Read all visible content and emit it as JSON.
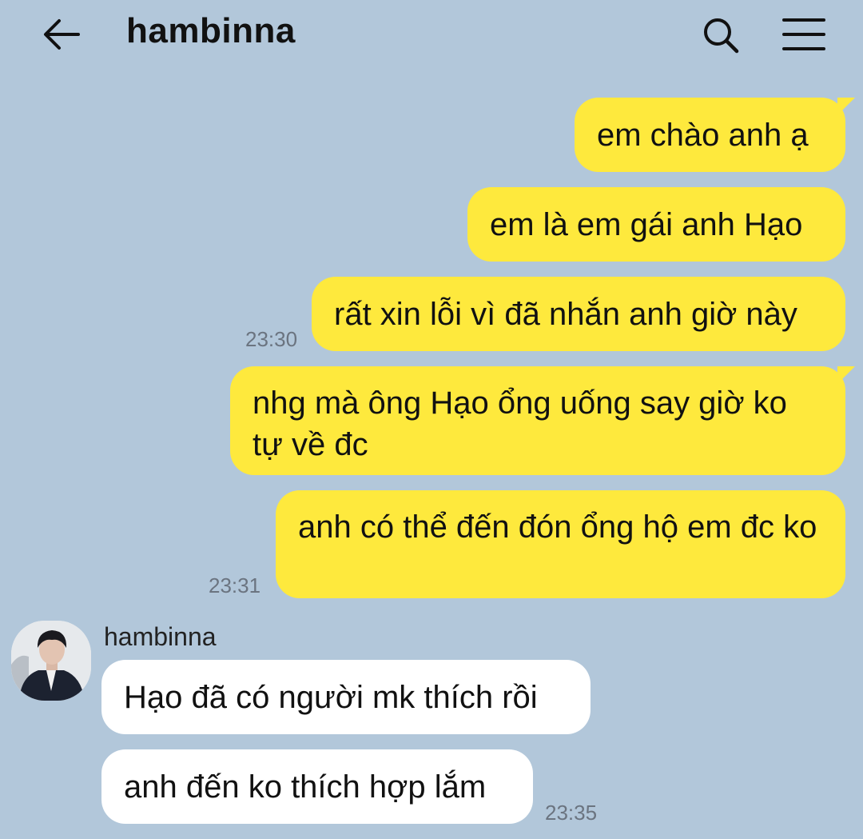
{
  "header": {
    "back_icon": "arrow-left-icon",
    "title": "hambinna",
    "search_icon": "search-icon",
    "menu_icon": "hamburger-menu-icon"
  },
  "colors": {
    "background": "#b2c7da",
    "outgoing_bubble": "#fee93d",
    "incoming_bubble": "#ffffff"
  },
  "messages": [
    {
      "direction": "outgoing",
      "text": "em chào anh ạ"
    },
    {
      "direction": "outgoing",
      "text": "em là em gái anh Hạo"
    },
    {
      "direction": "outgoing",
      "text": "rất xin lỗi vì đã nhắn anh giờ này",
      "time": "23:30"
    },
    {
      "direction": "outgoing",
      "text": "nhg mà ông Hạo ổng uống say giờ ko tự về đc"
    },
    {
      "direction": "outgoing",
      "text": "anh có thể đến đón ổng hộ em đc ko",
      "time": "23:31"
    },
    {
      "direction": "incoming",
      "sender": "hambinna",
      "text": "Hạo đã có người mk thích rồi"
    },
    {
      "direction": "incoming",
      "text": "anh đến ko thích hợp lắm",
      "time": "23:35"
    }
  ]
}
